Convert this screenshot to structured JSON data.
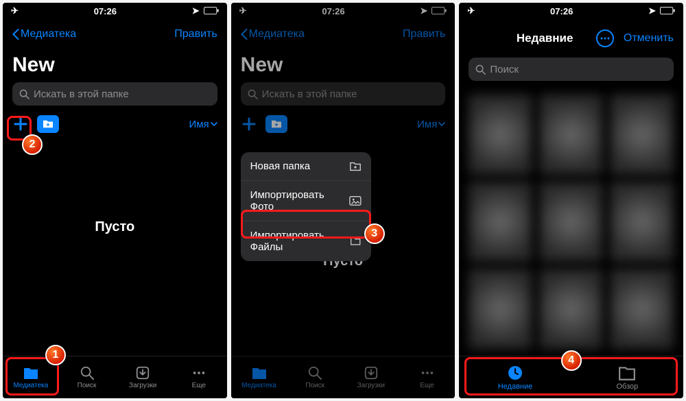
{
  "status": {
    "time": "07:26",
    "airplane": "✈︎",
    "location": "➤",
    "battery": "▢"
  },
  "nav": {
    "back": "Медиатека",
    "edit": "Править"
  },
  "title": "New",
  "search": {
    "placeholder": "Искать в этой папке"
  },
  "sort": {
    "label": "Имя"
  },
  "empty": "Пусто",
  "tabs": {
    "library": "Медиатека",
    "search": "Поиск",
    "downloads": "Загрузки",
    "more": "Еще"
  },
  "menu": {
    "new_folder": "Новая папка",
    "import_photo": "Импортировать Фото",
    "import_files": "Импортировать Файлы"
  },
  "screen3": {
    "title": "Недавние",
    "cancel": "Отменить",
    "search": "Поиск",
    "tab_recent": "Недавние",
    "tab_browse": "Обзор"
  },
  "badges": {
    "b1": "1",
    "b2": "2",
    "b3": "3",
    "b4": "4"
  }
}
